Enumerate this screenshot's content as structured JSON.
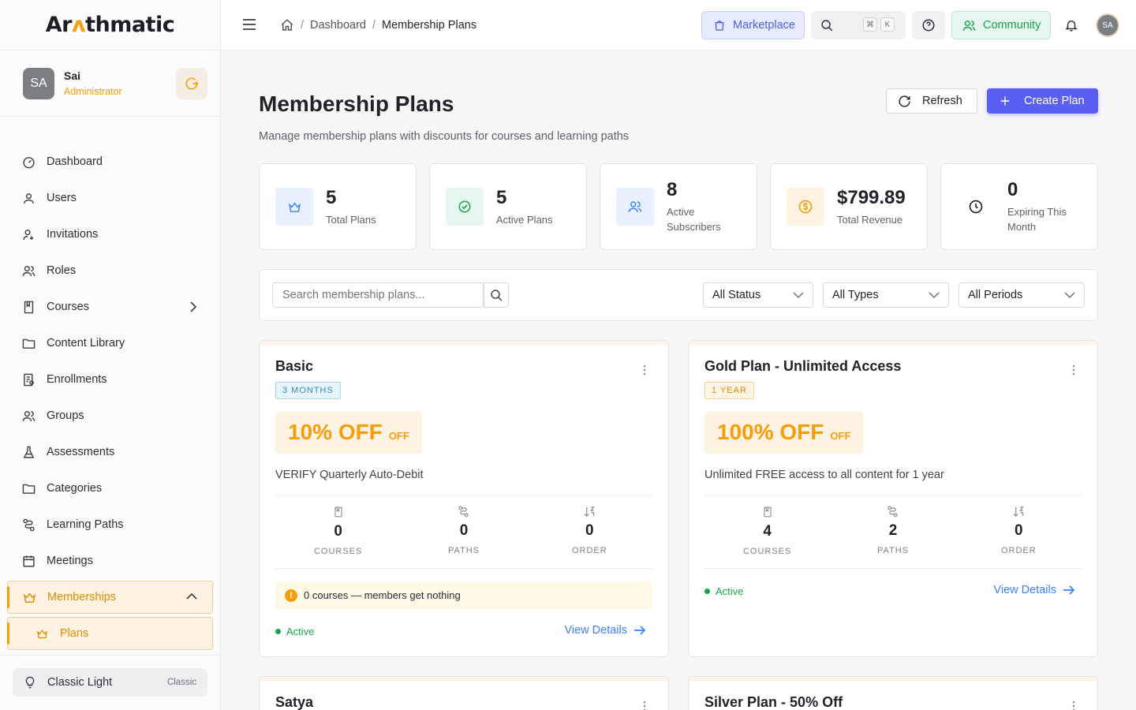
{
  "app": {
    "logo": "Arithmatic"
  },
  "user": {
    "initials": "SA",
    "name": "Sai",
    "role": "Administrator"
  },
  "sidebar": {
    "items": [
      {
        "label": "Dashboard",
        "icon": "dashboard-icon"
      },
      {
        "label": "Users",
        "icon": "user-icon"
      },
      {
        "label": "Invitations",
        "icon": "invite-icon"
      },
      {
        "label": "Roles",
        "icon": "roles-icon"
      },
      {
        "label": "Courses",
        "icon": "book-icon"
      },
      {
        "label": "Content Library",
        "icon": "folder-icon"
      },
      {
        "label": "Enrollments",
        "icon": "enrollment-icon"
      },
      {
        "label": "Groups",
        "icon": "groups-icon"
      },
      {
        "label": "Assessments",
        "icon": "flask-icon"
      },
      {
        "label": "Categories",
        "icon": "folder-icon"
      },
      {
        "label": "Learning Paths",
        "icon": "route-icon"
      },
      {
        "label": "Meetings",
        "icon": "calendar-icon"
      },
      {
        "label": "Memberships",
        "icon": "crown-icon"
      },
      {
        "label": "Plans",
        "icon": "crown-icon"
      }
    ],
    "theme": {
      "label": "Classic Light",
      "tag": "Classic"
    }
  },
  "topbar": {
    "breadcrumb": [
      "Dashboard",
      "Membership Plans"
    ],
    "marketplace": "Marketplace",
    "kbd": [
      "⌘",
      "K"
    ],
    "community": "Community",
    "avatar": "SA"
  },
  "page": {
    "title": "Membership Plans",
    "subtitle": "Manage membership plans with discounts for courses and learning paths",
    "refresh": "Refresh",
    "create": "Create Plan"
  },
  "stats": [
    {
      "value": "5",
      "label": "Total Plans"
    },
    {
      "value": "5",
      "label": "Active Plans"
    },
    {
      "value": "8",
      "label": "Active Subscribers"
    },
    {
      "value": "$799.89",
      "label": "Total Revenue"
    },
    {
      "value": "0",
      "label": "Expiring This Month"
    }
  ],
  "filters": {
    "search_placeholder": "Search membership plans...",
    "status": "All Status",
    "types": "All Types",
    "periods": "All Periods"
  },
  "metric_labels": {
    "courses": "COURSES",
    "paths": "PATHS",
    "order": "ORDER"
  },
  "plans": [
    {
      "title": "Basic",
      "period": "3 MONTHS",
      "discount": "10% OFF",
      "off": "OFF",
      "description": "VERIFY Quarterly Auto-Debit",
      "courses": "0",
      "paths": "0",
      "order": "0",
      "warning": "0 courses — members get nothing",
      "status": "Active",
      "action": "View Details"
    },
    {
      "title": "Gold Plan - Unlimited Access",
      "period": "1 YEAR",
      "discount": "100% OFF",
      "off": "OFF",
      "description": "Unlimited FREE access to all content for 1 year",
      "courses": "4",
      "paths": "2",
      "order": "0",
      "status": "Active",
      "action": "View Details"
    },
    {
      "title": "Satya"
    },
    {
      "title": "Silver Plan - 50% Off"
    }
  ],
  "colors": {
    "accent": "#f59e0b",
    "primary": "#5b5ef2",
    "success": "#16a34a",
    "link": "#3b82f6"
  }
}
